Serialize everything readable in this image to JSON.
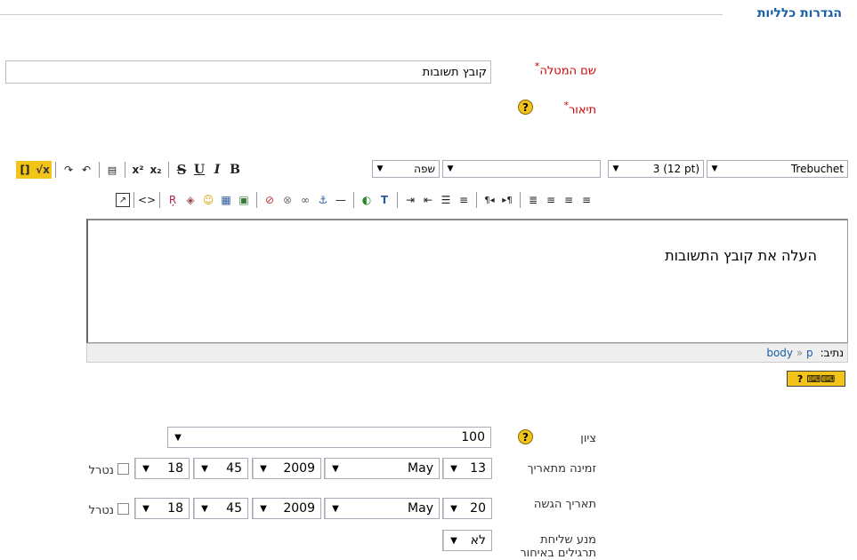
{
  "section": {
    "title": "הגדרות כלליות"
  },
  "assignment_name": {
    "label": "שם המטלה",
    "required_mark": "*",
    "value": "קובץ תשובות"
  },
  "description": {
    "label": "תיאור",
    "required_mark": "*",
    "help": "?"
  },
  "toolbar": {
    "font_family": "Trebuchet",
    "font_size": "3 (12 pt)",
    "style": "",
    "language": "שפה",
    "bold": "B",
    "italic": "I",
    "underline": "U",
    "strike": "S",
    "subscript": "x₂",
    "superscript": "x²"
  },
  "editor": {
    "content": "העלה את קובץ התשובות"
  },
  "path": {
    "label": "נתיב:",
    "body": "body",
    "sep": "»",
    "p": "p"
  },
  "keyboard_help": "?",
  "grade": {
    "label": "ציון",
    "value": "100",
    "help": "?"
  },
  "available_from": {
    "label": "זמינה מתאריך",
    "day": "13",
    "month": "May",
    "year": "2009",
    "hour": "18",
    "minute": "45",
    "disable_label": "נטרל"
  },
  "due_date": {
    "label": "תאריך הגשה",
    "day": "20",
    "month": "May",
    "year": "2009",
    "hour": "18",
    "minute": "45",
    "disable_label": "נטרל"
  },
  "prevent_late": {
    "label": "מנע שליחת תרגילים באיחור",
    "value": "לא"
  },
  "colors": {
    "accent": "#1a5fa8",
    "required": "#cc0000",
    "help": "#f2c318"
  }
}
